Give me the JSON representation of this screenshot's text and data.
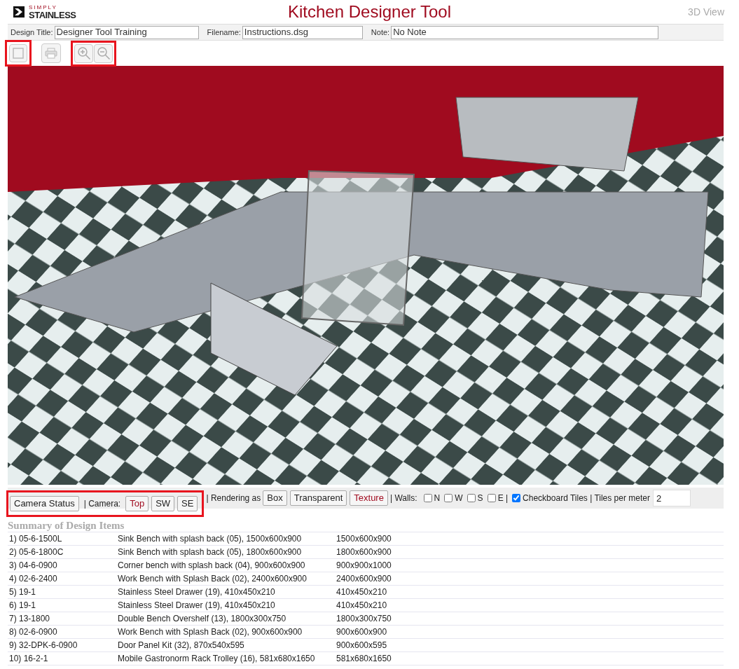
{
  "logo": {
    "top": "SIMPLY",
    "bottom": "STAINLESS"
  },
  "title": "Kitchen Designer Tool",
  "view_label": "3D View",
  "fields": [
    {
      "label": "Design Title:",
      "value": "Designer Tool Training"
    },
    {
      "label": "Filename:",
      "value": "Instructions.dsg"
    },
    {
      "label": "Note:",
      "value": "No Note"
    }
  ],
  "controls": {
    "camera_status": "Camera Status",
    "camera_label": "| Camera:",
    "cameras": [
      {
        "label": "Top",
        "selected": true
      },
      {
        "label": "SW",
        "selected": false
      },
      {
        "label": "SE",
        "selected": false
      }
    ],
    "rendering_label": "| Rendering as",
    "renderings": [
      {
        "label": "Box",
        "selected": false
      },
      {
        "label": "Transparent",
        "selected": false
      },
      {
        "label": "Texture",
        "selected": true
      }
    ],
    "walls_label": "| Walls:",
    "walls": [
      {
        "label": "N",
        "checked": false
      },
      {
        "label": "W",
        "checked": false
      },
      {
        "label": "S",
        "checked": false
      },
      {
        "label": "E |",
        "checked": false
      }
    ],
    "checkboard": {
      "label": "Checkboard Tiles | Tiles per meter",
      "checked": true
    },
    "tiles_per_meter": "2"
  },
  "summary": {
    "title": "Summary of Design Items",
    "rows": [
      [
        "1) 05-6-1500L",
        "Sink Bench with splash back (05), 1500x600x900",
        "1500x600x900"
      ],
      [
        "2) 05-6-1800C",
        "Sink Bench with splash back (05), 1800x600x900",
        "1800x600x900"
      ],
      [
        "3) 04-6-0900",
        "Corner bench with splash back (04), 900x600x900",
        "900x900x1000"
      ],
      [
        "4) 02-6-2400",
        "Work Bench with Splash Back (02), 2400x600x900",
        "2400x600x900"
      ],
      [
        "5) 19-1",
        "Stainless Steel Drawer (19), 410x450x210",
        "410x450x210"
      ],
      [
        "6) 19-1",
        "Stainless Steel Drawer (19), 410x450x210",
        "410x450x210"
      ],
      [
        "7) 13-1800",
        "Double Bench Overshelf (13), 1800x300x750",
        "1800x300x750"
      ],
      [
        "8) 02-6-0900",
        "Work Bench with Splash Back (02), 900x600x900",
        "900x600x900"
      ],
      [
        "9) 32-DPK-6-0900",
        "Door Panel Kit (32), 870x540x595",
        "900x600x595"
      ],
      [
        "10) 16-2-1",
        "Mobile Gastronorm Rack Trolley (16), 581x680x1650",
        "581x680x1650"
      ]
    ]
  }
}
